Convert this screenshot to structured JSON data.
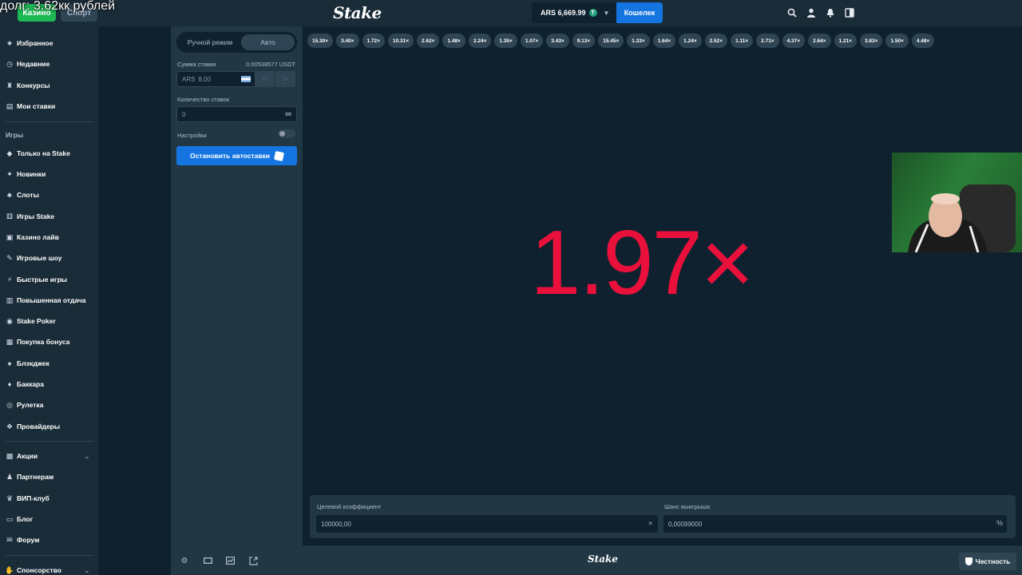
{
  "overlay": {
    "text": "долг: 3.62кк рублей"
  },
  "header": {
    "casino_tab": "Казино",
    "sport_tab": "Спорт",
    "logo": "Stake",
    "balance": "ARS 6,669.99",
    "coin_symbol": "T",
    "wallet_button": "Кошелек"
  },
  "sidebar": {
    "items_top": [
      "Избранное",
      "Недавние",
      "Конкурсы",
      "Мои ставки"
    ],
    "games_heading": "Игры",
    "games": [
      "Только на Stake",
      "Новинки",
      "Слоты",
      "Игры Stake",
      "Казино лайв",
      "Игровые шоу",
      "Быстрые игры",
      "Повышенная отдача",
      "Stake Poker",
      "Покупка бонуса",
      "Блэкджек",
      "Баккара",
      "Рулетка",
      "Провайдеры"
    ],
    "items_bottom": [
      "Акции",
      "Партнерам",
      "ВИП-клуб",
      "Блог",
      "Форум",
      "Спонсорство"
    ]
  },
  "panel": {
    "mode_manual": "Ручной режим",
    "mode_auto": "Авто",
    "bet_label": "Сумма ставки",
    "bet_crypto": "0.00538577 USDT",
    "bet_currency": "ARS",
    "bet_value": "8,00",
    "half_btn": "½",
    "double_btn": "2×",
    "count_label": "Количество ставок",
    "count_value": "0",
    "infinity": "∞",
    "settings_label": "Настройки",
    "stop_button": "Остановить автоставки"
  },
  "history": [
    "15.30×",
    "3.40×",
    "1.72×",
    "10.31×",
    "2.62×",
    "1.48×",
    "2.24×",
    "1.35×",
    "1.07×",
    "3.43×",
    "9.13×",
    "15.45×",
    "1.33×",
    "1.64×",
    "1.24×",
    "2.52×",
    "1.11×",
    "2.71×",
    "4.37×",
    "2.64×",
    "1.21×",
    "3.83×",
    "1.50×",
    "4.48×"
  ],
  "result": {
    "multiplier": "1.97×",
    "color": "#e9113c"
  },
  "bottom": {
    "target_label": "Целевой коэффициент",
    "target_value": "100000,00",
    "target_suffix": "×",
    "chance_label": "Шанс выигрыша",
    "chance_value": "0,00099000",
    "chance_suffix": "%"
  },
  "footer": {
    "logo": "Stake",
    "fairness": "Честность"
  },
  "colors": {
    "accent": "#1475e1",
    "casino_green": "#1db954",
    "panel": "#213743",
    "background": "#0f212e"
  }
}
